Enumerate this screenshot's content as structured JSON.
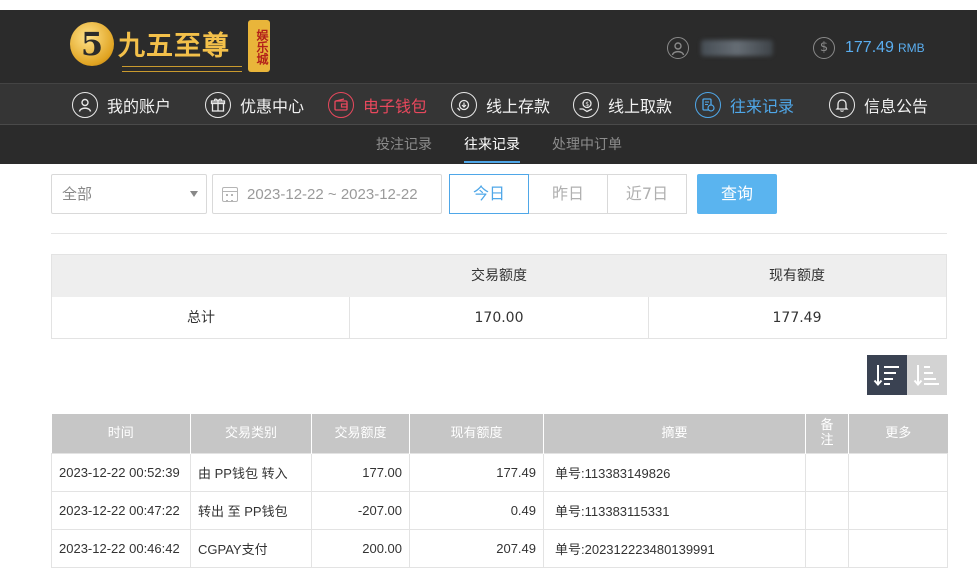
{
  "brand": {
    "logo_numeral": "5",
    "logo_text": "九五至尊",
    "logo_tag": "娱乐城"
  },
  "account": {
    "balance": "177.49",
    "currency": "RMB",
    "icons": {
      "user": "user-circle-icon",
      "balance": "dollar-coin-icon"
    }
  },
  "nav": {
    "items": [
      {
        "label": "我的账户",
        "icon": "user-icon"
      },
      {
        "label": "优惠中心",
        "icon": "gift-icon"
      },
      {
        "label": "电子钱包",
        "icon": "wallet-icon",
        "active": true,
        "color": "#e8485d"
      },
      {
        "label": "线上存款",
        "icon": "deposit-icon"
      },
      {
        "label": "线上取款",
        "icon": "withdraw-icon"
      },
      {
        "label": "往来记录",
        "icon": "records-icon",
        "active": true,
        "color": "#4fa7e8"
      },
      {
        "label": "信息公告",
        "icon": "bell-icon"
      }
    ]
  },
  "subnav": {
    "items": [
      {
        "label": "投注记录"
      },
      {
        "label": "往来记录",
        "active": true
      },
      {
        "label": "处理中订单"
      }
    ]
  },
  "filters": {
    "type_select": "全部",
    "date_range": "2023-12-22 ~ 2023-12-22",
    "quick_ranges": [
      "今日",
      "昨日",
      "近7日"
    ],
    "active_range": "今日",
    "query_label": "查询"
  },
  "summary": {
    "headers": [
      "",
      "交易额度",
      "现有额度"
    ],
    "row": {
      "label": "总计",
      "transaction": "170.00",
      "balance": "177.49"
    }
  },
  "sort": {
    "desc_icon": "sort-desc-icon",
    "asc_icon": "sort-asc-icon"
  },
  "records": {
    "headers": [
      "时间",
      "交易类别",
      "交易额度",
      "现有额度",
      "摘要",
      "备注",
      "更多"
    ],
    "rows": [
      {
        "time": "2023-12-22 00:52:39",
        "type": "由 PP钱包 转入",
        "amount": "177.00",
        "balance": "177.49",
        "summary": "单号:113383149826",
        "note": "",
        "more": ""
      },
      {
        "time": "2023-12-22 00:47:22",
        "type": "转出 至 PP钱包",
        "amount": "-207.00",
        "balance": "0.49",
        "summary": "单号:113383115331",
        "note": "",
        "more": ""
      },
      {
        "time": "2023-12-22 00:46:42",
        "type": "CGPAY支付",
        "amount": "200.00",
        "balance": "207.49",
        "summary": "单号:202312223480139991",
        "note": "",
        "more": ""
      }
    ]
  },
  "colors": {
    "header_bg": "#2b2b2b",
    "accent_blue": "#4fa7e8",
    "accent_red": "#e8485d",
    "gold": "#f3c04a"
  }
}
